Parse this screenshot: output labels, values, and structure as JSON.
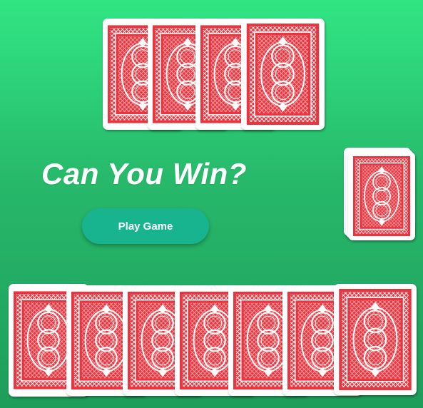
{
  "game": {
    "title": "Can You Win?",
    "play_button_label": "Play Game"
  },
  "colors": {
    "table_top": "#31e583",
    "table_bottom": "#1e9d5a",
    "card_back_red": "#e8353f",
    "card_face": "#ffffff",
    "button": "#17b48f"
  },
  "table": {
    "opponent_hand": {
      "card_count": 4,
      "face": "down"
    },
    "deck": {
      "face": "down"
    },
    "player_hand": {
      "card_count": 7,
      "face": "down"
    }
  }
}
